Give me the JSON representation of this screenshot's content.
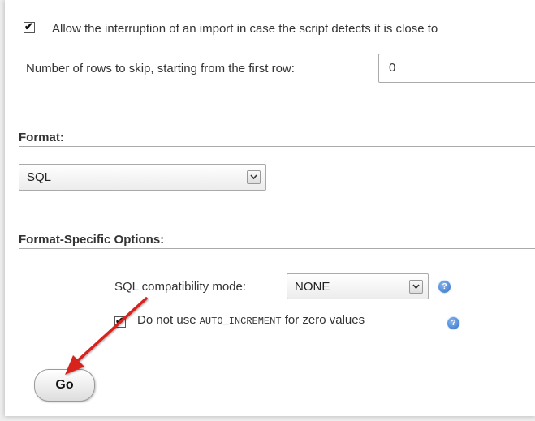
{
  "import_options": {
    "allow_interrupt_label": "Allow the interruption of an import in case the script detects it is close to",
    "allow_interrupt_checked": true,
    "skip_rows_label": "Number of rows to skip, starting from the first row:",
    "skip_rows_value": "0"
  },
  "format": {
    "title": "Format:",
    "selected": "SQL"
  },
  "format_specific": {
    "title": "Format-Specific Options:",
    "compat_label": "SQL compatibility mode:",
    "compat_selected": "NONE",
    "auto_inc_prefix": "Do not use",
    "auto_inc_code": "AUTO_INCREMENT",
    "auto_inc_suffix": "for zero values",
    "auto_inc_checked": true
  },
  "actions": {
    "go_label": "Go"
  },
  "icons": {
    "help": "help-icon",
    "checkmark": "checkmark-icon",
    "dropdown": "chevron-down-icon",
    "annotation_arrow": "arrow-icon"
  },
  "colors": {
    "arrow": "#d8231f",
    "help": "#2f6fc6"
  }
}
